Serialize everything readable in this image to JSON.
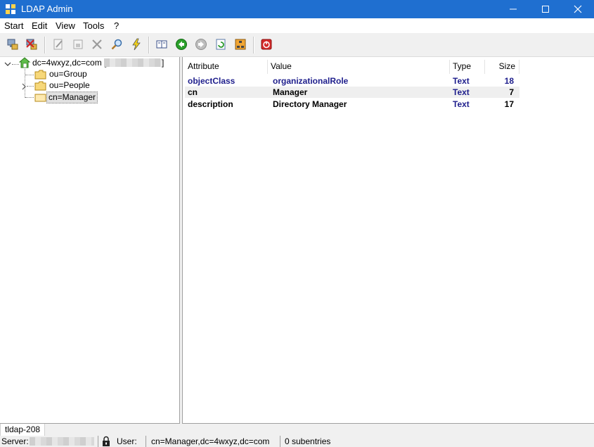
{
  "window": {
    "title": "LDAP Admin"
  },
  "menu": [
    "Start",
    "Edit",
    "View",
    "Tools",
    "?"
  ],
  "toolbar_icons": [
    "connect-icon",
    "disconnect-icon",
    "edit-icon",
    "properties-icon",
    "delete-icon",
    "search-icon",
    "lightning-icon",
    "schema-book-icon",
    "back-icon",
    "forward-icon",
    "refresh-icon",
    "ldif-icon",
    "exit-icon"
  ],
  "tree": {
    "root": {
      "label": "dc=4wxyz,dc=com [",
      "suffix": "]"
    },
    "children": [
      {
        "label": "ou=Group"
      },
      {
        "label": "ou=People"
      },
      {
        "label": "cn=Manager"
      }
    ]
  },
  "grid": {
    "columns": [
      "Attribute",
      "Value",
      "Type",
      "Size"
    ],
    "rows": [
      {
        "attribute": "objectClass",
        "value": "organizationalRole",
        "type": "Text",
        "size": "18"
      },
      {
        "attribute": "cn",
        "value": "Manager",
        "type": "Text",
        "size": "7"
      },
      {
        "attribute": "description",
        "value": "Directory Manager",
        "type": "Text",
        "size": "17"
      }
    ],
    "colors": {
      "highlight": "#1e1e8c",
      "normal": "#000000"
    }
  },
  "tab": "tldap-208",
  "status": {
    "server_label": "Server:",
    "user_label": "User:",
    "dn": "cn=Manager,dc=4wxyz,dc=com",
    "subentries": "0 subentries"
  },
  "colors": {
    "titlebar": "#1f6fd0",
    "chrome": "#f0f0f0"
  }
}
